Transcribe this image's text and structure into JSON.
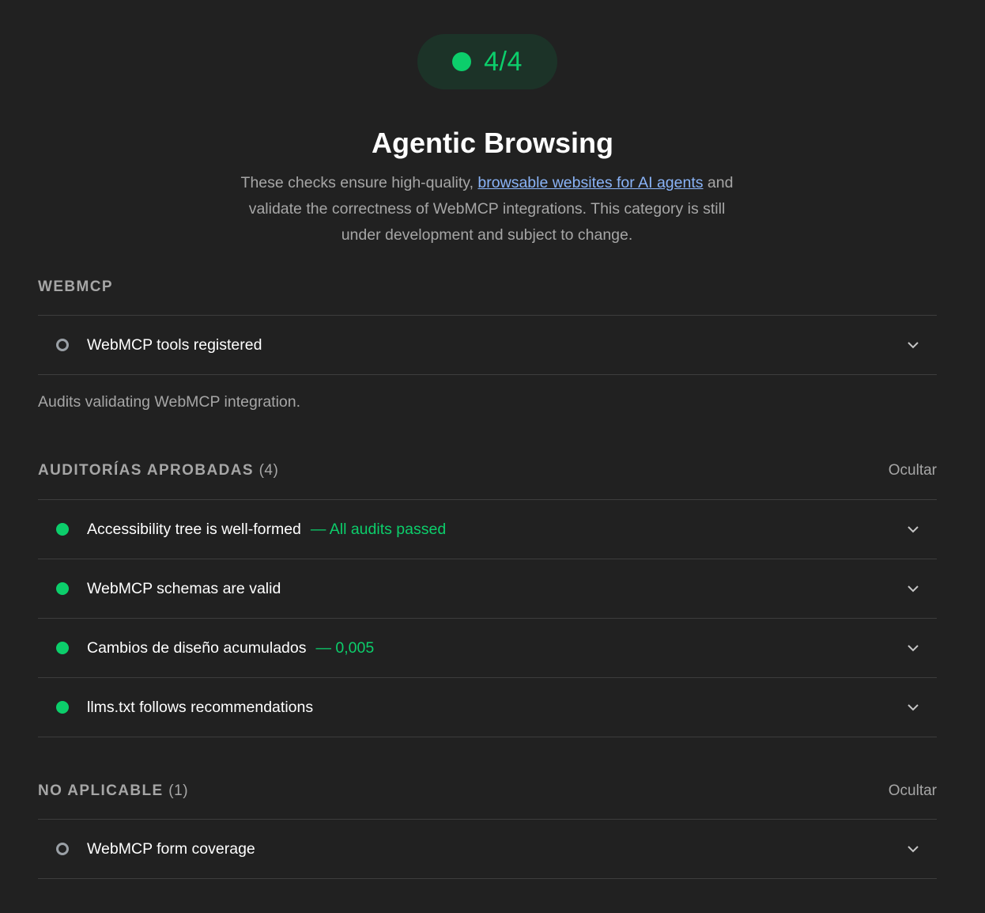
{
  "score": {
    "value": "4/4",
    "color": "#0cce6b"
  },
  "category": {
    "title": "Agentic Browsing",
    "desc_before": "These checks ensure high-quality, ",
    "desc_link": "browsable websites for AI agents",
    "desc_after": " and validate the correctness of WebMCP integrations. This category is still under development and subject to change."
  },
  "webmcp_group": {
    "title": "WEBMCP",
    "items": [
      {
        "title": "WebMCP tools registered",
        "display": "",
        "status": "na"
      }
    ],
    "description": "Audits validating WebMCP integration."
  },
  "passed_group": {
    "title": "AUDITORÍAS APROBADAS",
    "count": "(4)",
    "toggle": "Ocultar",
    "items": [
      {
        "title": "Accessibility tree is well-formed",
        "display": "— All audits passed",
        "status": "pass"
      },
      {
        "title": "WebMCP schemas are valid",
        "display": "",
        "status": "pass"
      },
      {
        "title": "Cambios de diseño acumulados",
        "display": "— 0,005",
        "status": "pass"
      },
      {
        "title": "llms.txt follows recommendations",
        "display": "",
        "status": "pass"
      }
    ]
  },
  "na_group": {
    "title": "NO APLICABLE",
    "count": "(1)",
    "toggle": "Ocultar",
    "items": [
      {
        "title": "WebMCP form coverage",
        "display": "",
        "status": "na"
      }
    ]
  },
  "icons": {
    "pass": "pass-dot-icon",
    "na": "not-applicable-ring-icon",
    "expand": "chevron-down-icon"
  }
}
